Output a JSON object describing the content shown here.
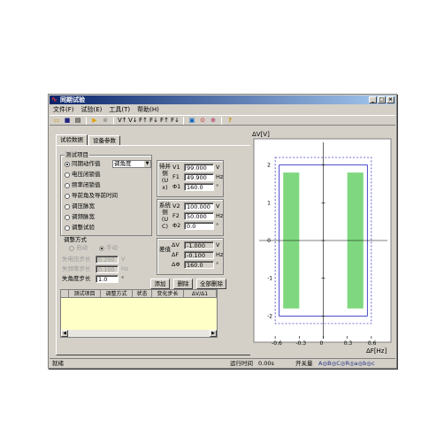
{
  "window": {
    "title": "同期试验",
    "btn_min": "_",
    "btn_max": "□",
    "btn_close": "×"
  },
  "menu": [
    "文件(F)",
    "试验(E)",
    "工具(T)",
    "帮助(H)"
  ],
  "toolbar": {
    "icons": [
      "open-icon",
      "save-icon",
      "print-icon",
      "run-icon",
      "stop-icon",
      "v-up-icon",
      "v-down-icon",
      "f-up-icon",
      "f-down-icon",
      "ff-up-icon",
      "ff-down-icon",
      "monitor-icon",
      "record-icon",
      "zoom-icon",
      "help-icon"
    ],
    "labels": {
      "v_up": "V↑",
      "v_down": "V↓",
      "f_up": "F↑",
      "f_down": "F↓",
      "ff_up": "F↑",
      "ff_down": "F↓",
      "help": "?"
    }
  },
  "tabs": [
    "试验数据",
    "设备参数"
  ],
  "test_items": {
    "legend": "测试项目",
    "items": [
      "同期动作值",
      "电压闭锁值",
      "频率闭锁值",
      "导前角及导前时间",
      "调压脉宽",
      "调频脉宽",
      "调整试验"
    ],
    "selected": 0,
    "combo_value": "调角度"
  },
  "adjust_mode": {
    "legend": "调整方式",
    "options": [
      "自动",
      "手动"
    ],
    "selected": 1
  },
  "steps": {
    "voltage_label": "失电压步长",
    "voltage_value": "0.200",
    "voltage_unit": "V",
    "freq_label": "失频率步长",
    "freq_value": "0.100",
    "freq_unit": "Hz",
    "angle_label": "失角度步长",
    "angle_value": "1.0",
    "angle_unit": "°"
  },
  "grid_side": {
    "label": "待并侧(Ux)",
    "v1_label": "V1",
    "v1_value": "99.000",
    "v1_unit": "V",
    "f1_label": "F1",
    "f1_value": "49.900",
    "f1_unit": "Hz",
    "p1_label": "Φ1",
    "p1_value": "160.0",
    "p1_unit": "°"
  },
  "system_side": {
    "label": "系统侧(UC)",
    "v2_label": "V2",
    "v2_value": "100.000",
    "v2_unit": "V",
    "f2_label": "F2",
    "f2_value": "50.000",
    "f2_unit": "Hz",
    "p2_label": "Φ2",
    "p2_value": "0.0",
    "p2_unit": "°"
  },
  "difference": {
    "label": "差值",
    "dv_label": "ΔV",
    "dv_value": "-1.000",
    "dv_unit": "V",
    "df_label": "ΔF",
    "df_value": "-0.100",
    "df_unit": "Hz",
    "dp_label": "ΔΦ",
    "dp_value": "160.0",
    "dp_unit": "°"
  },
  "buttons": {
    "add": "添加",
    "delete": "删除",
    "delete_all": "全部删除"
  },
  "table": {
    "columns": [
      "",
      "测试项目",
      "调整方式",
      "状态",
      "变化步长",
      "ΔV/Δ1"
    ]
  },
  "chart_data": {
    "type": "scatter",
    "ylabel": "ΔV[V]",
    "xlabel": "ΔF[Hz]",
    "xlim": [
      -0.8,
      0.8
    ],
    "ylim": [
      -2.6,
      2.6
    ],
    "xticks": [
      "-0.6",
      "-0.3",
      "0",
      "0.3",
      "0.6"
    ],
    "yticks": [
      "2",
      "1",
      "0",
      "-1",
      "-2"
    ],
    "green_bands": [
      [
        -0.5,
        -0.3
      ],
      [
        0.3,
        0.5
      ]
    ],
    "band_ylim": [
      -1.8,
      1.8
    ],
    "blue_box": [
      -0.55,
      0.55,
      -2.0,
      2.0
    ],
    "dotted_box": [
      -0.6,
      0.6,
      -2.2,
      2.2
    ],
    "colors": {
      "band": "#7fd87f",
      "box": "#2020c0",
      "axis": "#000000"
    }
  },
  "status": {
    "ready": "就绪",
    "runtime_label": "运行时间",
    "runtime_value": "0.00s",
    "switch_label": "开关量",
    "switches": "A◎B◎C◎R◎a◎b◎c"
  }
}
